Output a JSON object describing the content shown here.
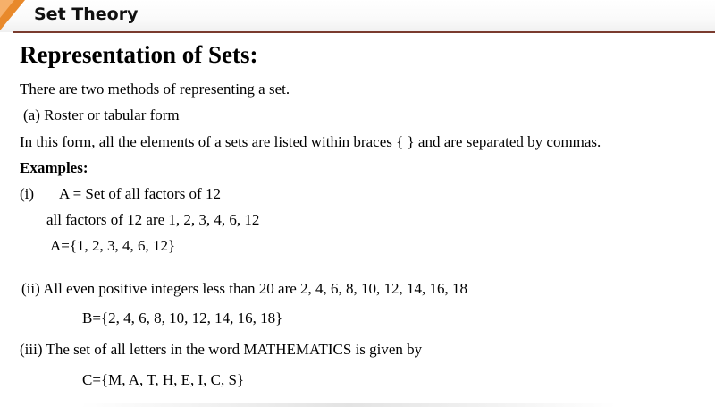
{
  "header": {
    "title": "Set Theory"
  },
  "heading": "Representation of Sets:",
  "intro": "There are two methods of representing a set.",
  "roster_label": "(a) Roster or tabular form",
  "roster_desc": "In this form, all the elements of a sets are listed within braces { }   and are separated by commas.",
  "examples_label": "Examples:",
  "example_1": {
    "num": "(i)",
    "statement": "A = Set of all factors of 12",
    "detail": "all factors of 12 are 1, 2, 3, 4, 6, 12",
    "result": "A={1, 2, 3, 4, 6, 12}"
  },
  "example_2": {
    "statement": "(ii) All even positive integers less than 20 are 2, 4, 6, 8, 10, 12, 14, 16, 18",
    "result": "B={2, 4, 6, 8, 10, 12, 14, 16, 18}"
  },
  "example_3": {
    "statement": "(iii) The set of all letters in the word MATHEMATICS is given by",
    "result": "C={M, A, T, H, E, I, C, S}"
  },
  "colors": {
    "accent": "#e8892b",
    "rule": "#7a3b2e"
  }
}
